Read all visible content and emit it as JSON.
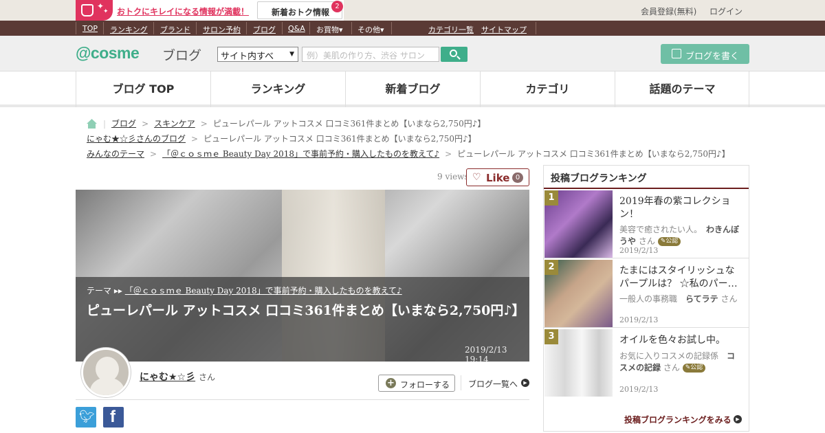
{
  "topbar": {
    "promo_text": "おトクにキレイになる情報が満載！",
    "new_info_label": "新着おトク情報",
    "new_info_count": "2",
    "register": "会員登録(無料)",
    "login": "ログイン"
  },
  "nav": {
    "items": [
      "TOP",
      "ランキング",
      "ブランド",
      "サロン予約",
      "ブログ",
      "Q&A",
      "お買物▾",
      "その他▾"
    ],
    "right_items": [
      "カテゴリ一覧",
      "サイトマップ"
    ]
  },
  "header": {
    "logo": "@cosme",
    "logo_sub": "ブログ",
    "scope_select": "サイト内すべ",
    "search_placeholder": "例）美肌の作り方、渋谷 サロン",
    "write_button": "ブログを書く"
  },
  "gnav": [
    "ブログ TOP",
    "ランキング",
    "新着ブログ",
    "カテゴリ",
    "話題のテーマ"
  ],
  "breadcrumbs": {
    "row1": [
      "ブログ",
      "スキンケア"
    ],
    "row1_current": "ピューレパール アットコスメ 口コミ361件まとめ【いまなら2,750円♪】",
    "row2_link": "にゃむ★☆彡さんのブログ",
    "row2_current": "ピューレパール アットコスメ 口コミ361件まとめ【いまなら2,750円♪】",
    "row3": [
      "みんなのテーマ",
      "「＠ｃｏｓｍｅ Beauty Day 2018」で事前予約・購入したものを教えて♪"
    ],
    "row3_current": "ピューレパール アットコスメ 口コミ361件まとめ【いまなら2,750円♪】"
  },
  "post": {
    "views": "9 views",
    "like_label": "Like",
    "like_count": "0",
    "theme_label": "テーマ",
    "theme_link": "「＠ｃｏｓｍｅ Beauty Day 2018」で事前予約・購入したものを教えて♪",
    "title": "ピューレパール アットコスメ 口コミ361件まとめ【いまなら2,750円♪】",
    "date": "2019/2/13 19:14",
    "author": "にゃむ★☆彡",
    "author_suffix": "さん",
    "follow": "フォローする",
    "blog_list": "ブログ一覧へ"
  },
  "ranking": {
    "heading": "投稿ブログランキング",
    "items": [
      {
        "rank": "1",
        "title": "2019年春の紫コレクション！",
        "author_desc": "美容で癒されたい人。",
        "author": "わきんぼうや",
        "suffix": "さん",
        "badge": "公認",
        "date": "2019/2/13"
      },
      {
        "rank": "2",
        "title": "たまにはスタイリッシュなパープルは？ ☆私のパー…",
        "author_desc": "一般人の事務職",
        "author": "らてラテ",
        "suffix": "さん",
        "badge": "",
        "date": "2019/2/13"
      },
      {
        "rank": "3",
        "title": "オイルを色々お試し中。",
        "author_desc": "お気に入りコスメの記録係",
        "author": "コスメの記録",
        "suffix": "さん",
        "badge": "公認",
        "date": "2019/2/13"
      }
    ],
    "more": "投稿ブログランキングをみる"
  }
}
